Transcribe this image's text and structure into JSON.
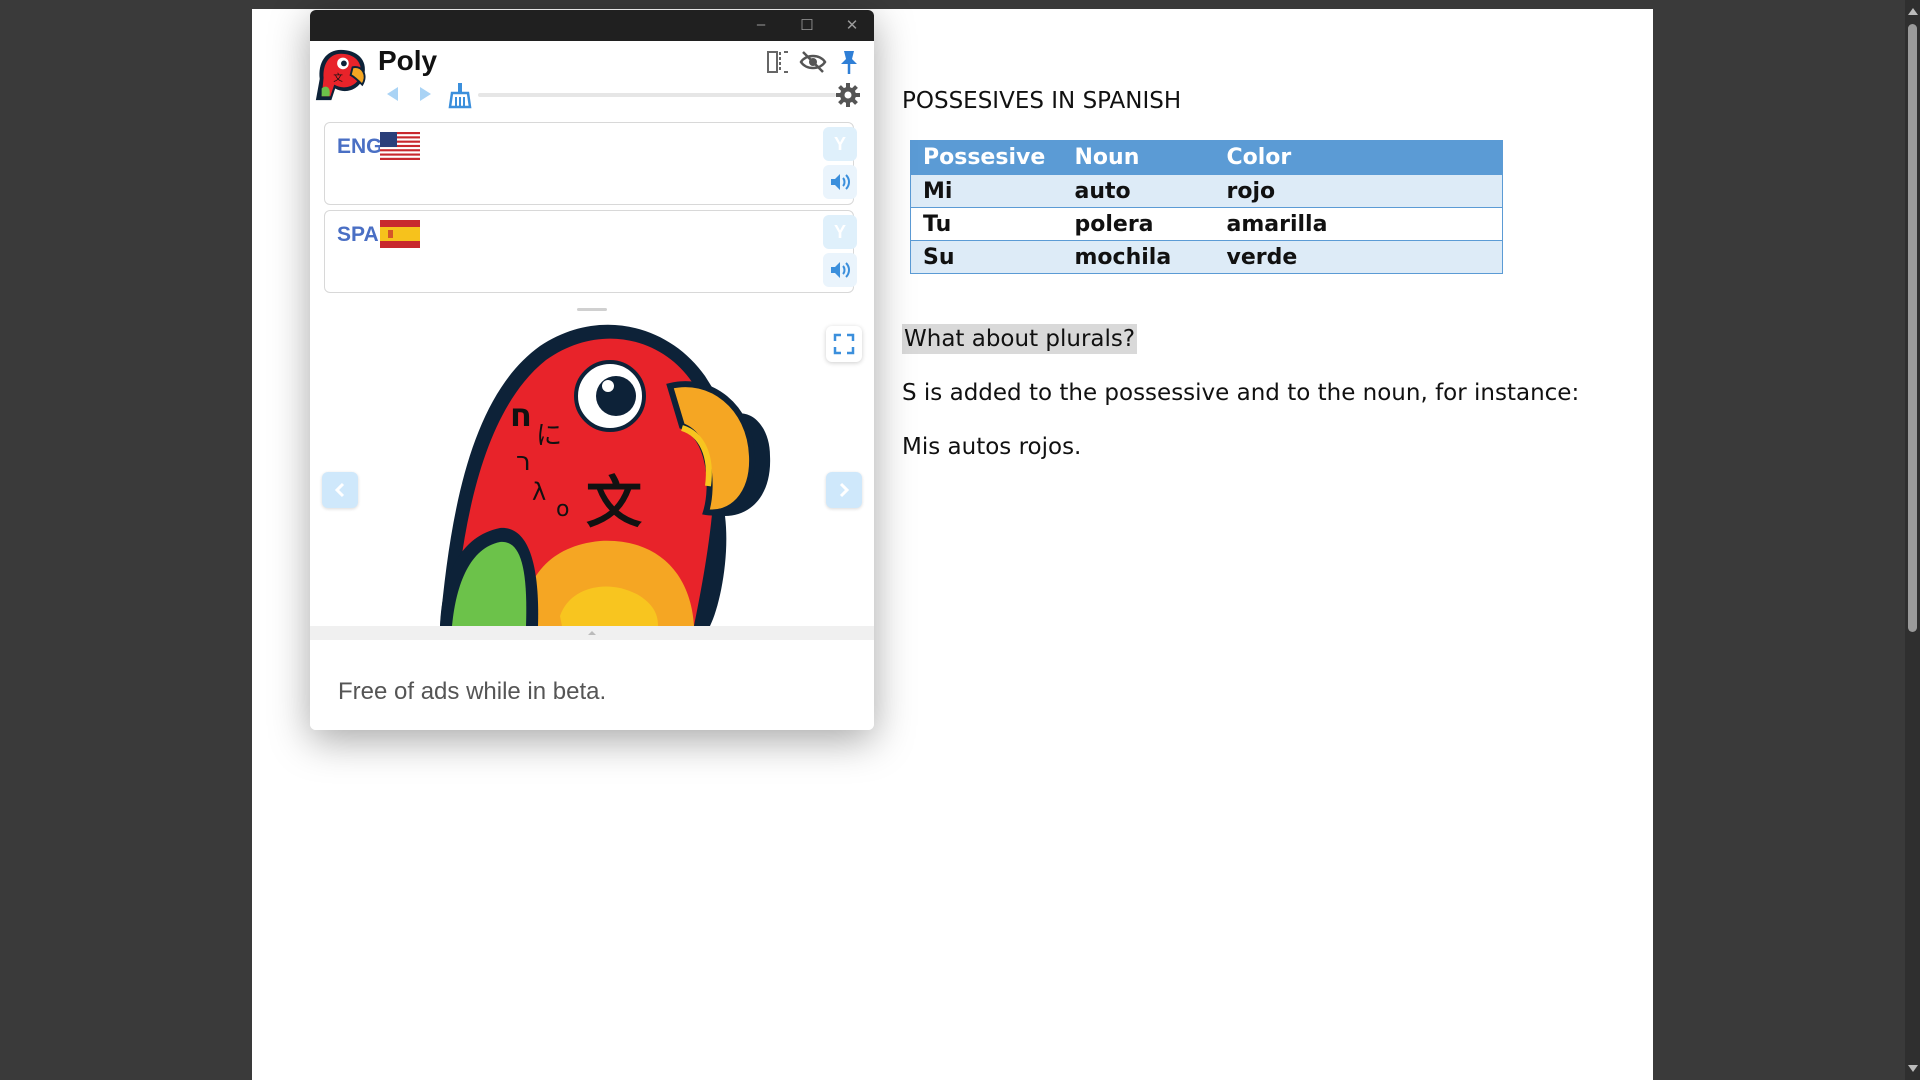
{
  "document": {
    "heading": "POSSESIVES IN SPANISH",
    "table": {
      "headers": [
        "Possesive",
        "Noun",
        "Color"
      ],
      "rows": [
        [
          "Mi",
          "auto",
          "rojo"
        ],
        [
          "Tu",
          "polera",
          "amarilla"
        ],
        [
          "Su",
          "mochila",
          "verde"
        ]
      ]
    },
    "question": "What about plurals?",
    "explanation": "S is added to the possessive and to the noun, for instance:",
    "example": "Mis autos rojos."
  },
  "poly": {
    "app_title": "Poly",
    "window_controls": {
      "minimize": "–",
      "maximize": "☐",
      "close": "✕"
    },
    "languages": [
      {
        "code": "ENG",
        "flag": "us-flag-icon",
        "y_label": "Y"
      },
      {
        "code": "SPA",
        "flag": "spain-flag-icon",
        "y_label": "Y"
      }
    ],
    "footer_text": "Free of ads while in beta.",
    "colors": {
      "accent": "#4a6fc4",
      "soft_button": "#dff0fb",
      "icon_blue": "#3b8fdc"
    }
  }
}
